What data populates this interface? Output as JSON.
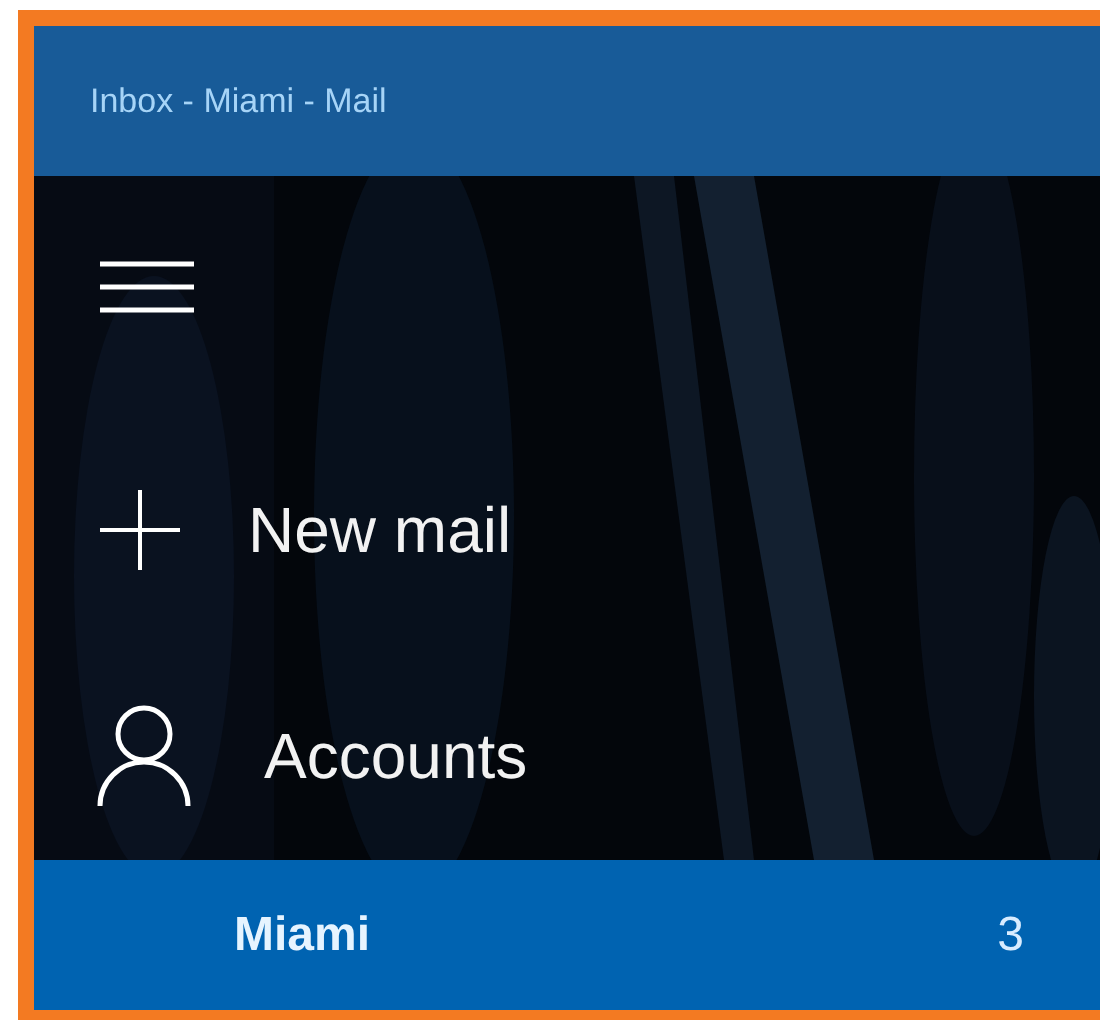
{
  "window": {
    "title": "Inbox - Miami - Mail"
  },
  "nav_items": [
    {
      "kind": "plus",
      "label": "New mail"
    },
    {
      "kind": "person",
      "label": "Accounts"
    }
  ],
  "accounts": [
    {
      "name": "Miami",
      "count": "3",
      "selected": true
    }
  ]
}
